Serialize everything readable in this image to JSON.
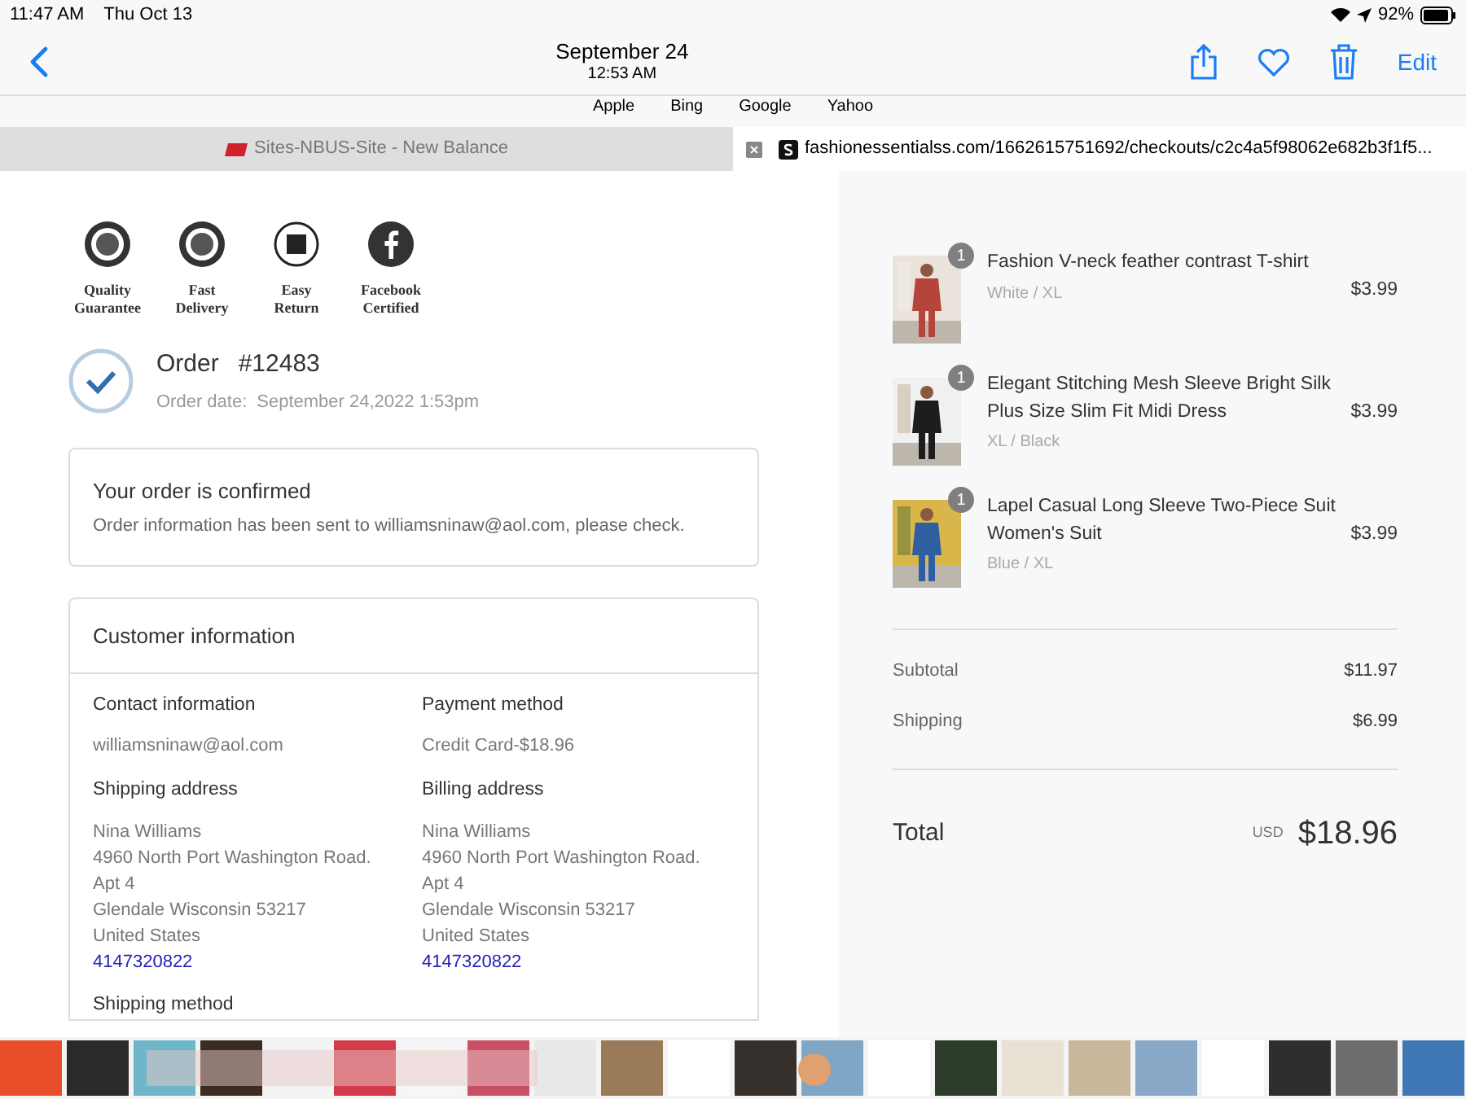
{
  "status_bar": {
    "time": "11:47 AM",
    "date": "Thu Oct 13",
    "battery": "92%"
  },
  "nav": {
    "title": "September 24",
    "subtitle": "12:53 AM",
    "edit": "Edit"
  },
  "favorites": [
    "Apple",
    "Bing",
    "Google",
    "Yahoo"
  ],
  "tabs": [
    {
      "title": "Sites-NBUS-Site - New Balance",
      "selected": false
    },
    {
      "title": "fashionessentialss.com/1662615751692/checkouts/c2c4a5f98062e682b3f1f5...",
      "selected": true
    }
  ],
  "badges": [
    {
      "label": "Quality",
      "label2": "Guarantee",
      "kind": "seal"
    },
    {
      "label": "Fast",
      "label2": "Delivery",
      "kind": "seal"
    },
    {
      "label": "Easy",
      "label2": "Return",
      "kind": "box"
    },
    {
      "label": "Facebook",
      "label2": "Certified",
      "kind": "facebook"
    }
  ],
  "order": {
    "title": "Order",
    "number": "#12483",
    "date_label": "Order date:",
    "date": "September 24,2022 1:53pm"
  },
  "confirmation": {
    "title": "Your order is confirmed",
    "text": "Order information has been sent to williamsninaw@aol.com, please check."
  },
  "customer": {
    "title": "Customer information",
    "sections": [
      {
        "title": "Contact information",
        "lines": [
          "williamsninaw@aol.com"
        ]
      },
      {
        "title": "Payment method",
        "lines": [
          "Credit Card-$18.96"
        ]
      },
      {
        "title": "Shipping address",
        "lines": [
          "Nina Williams",
          "4960 North Port Washington Road.",
          "Apt 4",
          "Glendale Wisconsin 53217",
          "United States"
        ],
        "phone": "4147320822"
      },
      {
        "title": "Billing address",
        "lines": [
          "Nina Williams",
          "4960 North Port Washington Road.",
          "Apt 4",
          "Glendale Wisconsin 53217",
          "United States"
        ],
        "phone": "4147320822"
      }
    ],
    "next_section": "Shipping method"
  },
  "items": [
    {
      "name": "Fashion V-neck feather contrast T-shirt",
      "variant": "White / XL",
      "price": "$3.99",
      "quantity": "1"
    },
    {
      "name": "Elegant Stitching Mesh Sleeve Bright Silk Plus Size Slim Fit Midi Dress",
      "variant": "XL / Black",
      "price": "$3.99",
      "quantity": "1"
    },
    {
      "name": "Lapel Casual Long Sleeve Two-Piece Suit Women's Suit",
      "variant": "Blue / XL",
      "price": "$3.99",
      "quantity": "1"
    }
  ],
  "summary": [
    {
      "label": "Subtotal",
      "value": "$11.97"
    },
    {
      "label": "Shipping",
      "value": "$6.99"
    }
  ],
  "total": {
    "label": "Total",
    "currency": "USD",
    "value": "$18.96"
  }
}
